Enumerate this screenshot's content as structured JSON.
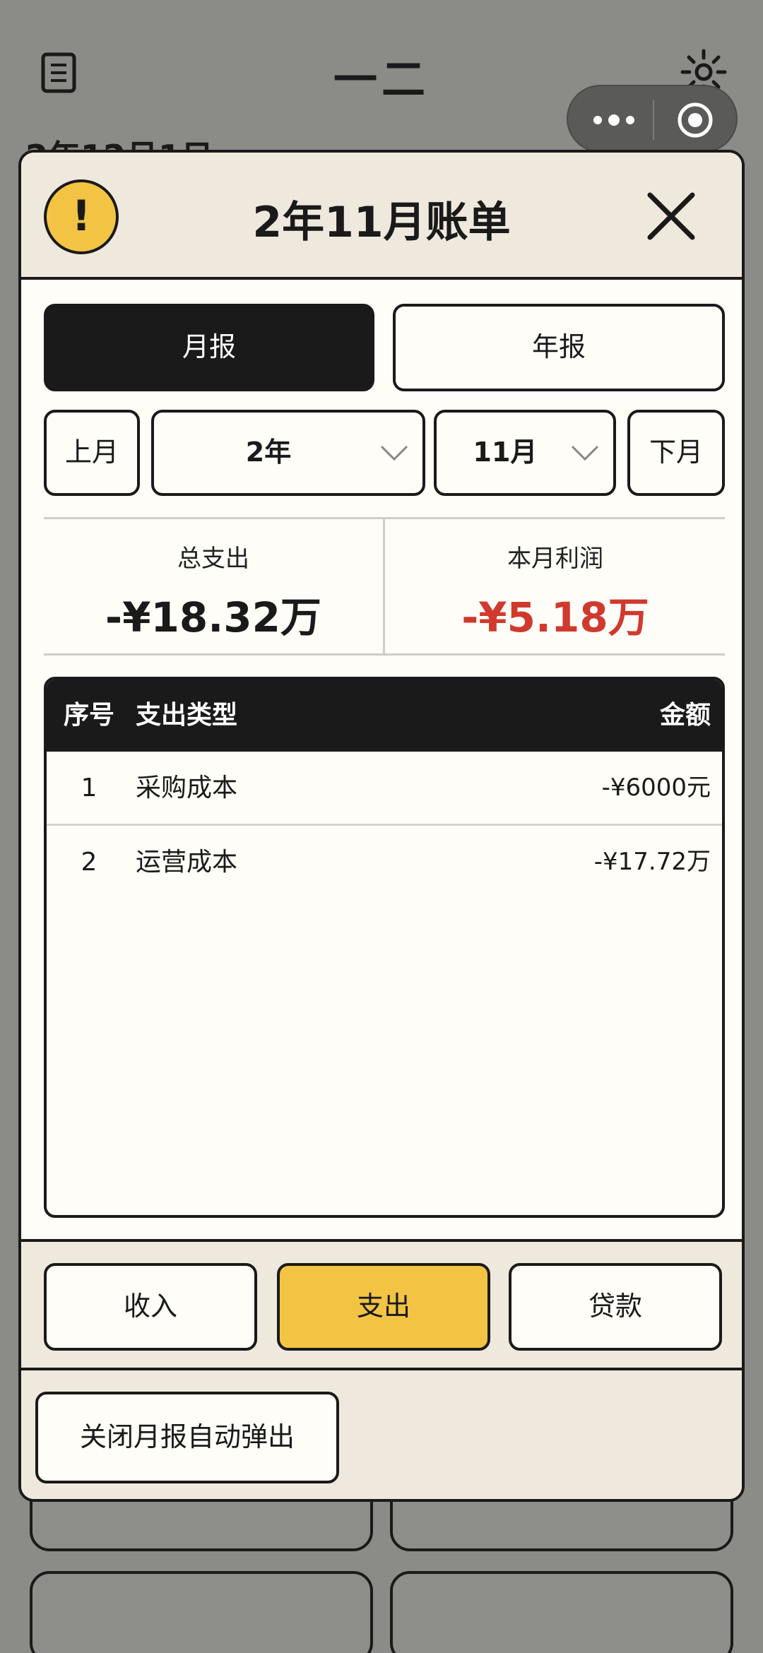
{
  "background": {
    "app_title": "一二",
    "date_text": "2年12月1日"
  },
  "modal": {
    "title": "2年11月账单",
    "tabs": [
      {
        "label": "月报",
        "active": true
      },
      {
        "label": "年报",
        "active": false
      }
    ],
    "selectors": {
      "prev_label": "上月",
      "year_value": "2年",
      "month_value": "11月",
      "next_label": "下月"
    },
    "stats": {
      "total_expense_label": "总支出",
      "total_expense_value": "-¥18.32万",
      "profit_label": "本月利润",
      "profit_value": "-¥5.18万",
      "profit_color": "#d03a2e"
    },
    "table": {
      "headers": {
        "no": "序号",
        "type": "支出类型",
        "amount": "金额"
      },
      "rows": [
        {
          "no": "1",
          "type": "采购成本",
          "amount": "-¥6000元"
        },
        {
          "no": "2",
          "type": "运营成本",
          "amount": "-¥17.72万"
        }
      ]
    },
    "footer_buttons": {
      "income": "收入",
      "expense": "支出",
      "loan": "贷款"
    },
    "auto_popup_label": "关闭月报自动弹出"
  },
  "colors": {
    "accent_yellow": "#f3c443",
    "dark": "#1a1a1a",
    "panel": "#efe9dd"
  }
}
